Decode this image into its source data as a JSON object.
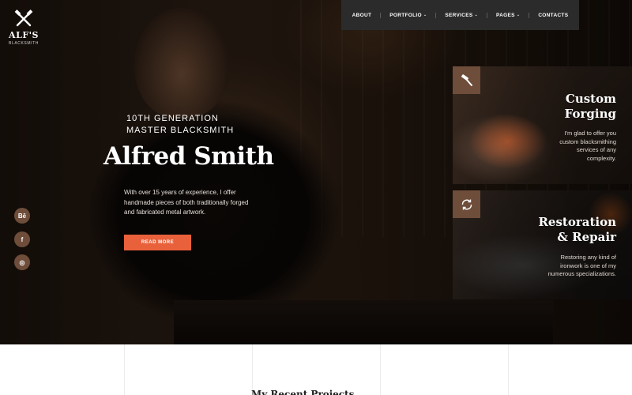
{
  "logo": {
    "name": "ALF'S",
    "sub": "BLACKSMITH"
  },
  "nav": {
    "items": [
      {
        "label": "ABOUT",
        "dropdown": false
      },
      {
        "label": "PORTFOLIO",
        "dropdown": true
      },
      {
        "label": "SERVICES",
        "dropdown": true
      },
      {
        "label": "PAGES",
        "dropdown": true
      },
      {
        "label": "CONTACTS",
        "dropdown": false
      }
    ],
    "chevron": "⌄"
  },
  "social": [
    {
      "icon": "behance-icon",
      "glyph": "Bē"
    },
    {
      "icon": "facebook-icon",
      "glyph": "f"
    },
    {
      "icon": "instagram-icon",
      "glyph": "◎"
    }
  ],
  "hero": {
    "eyebrow_line1": "10TH GENERATION",
    "eyebrow_line2": "MASTER BLACKSMITH",
    "title": "Alfred Smith",
    "description": "With over 15 years of experience, I offer handmade pieces of both traditionally forged and fabricated metal artwork.",
    "button": "READ MORE"
  },
  "cards": [
    {
      "icon": "hammer-icon",
      "title_line1": "Custom",
      "title_line2": "Forging",
      "text_lines": [
        "I'm glad to offer you",
        "custom blacksmithing",
        "services of any",
        "complexity."
      ]
    },
    {
      "icon": "refresh-icon",
      "title_line1": "Restoration",
      "title_line2": "& Repair",
      "text_lines": [
        "Restoring any kind of",
        "ironwork is one of my",
        "numerous specializations."
      ]
    }
  ],
  "section_peek": "My Recent Projects",
  "colors": {
    "accent": "#e9613b",
    "brown": "#6e4d3a",
    "nav_bg": "#2b2b2b"
  }
}
